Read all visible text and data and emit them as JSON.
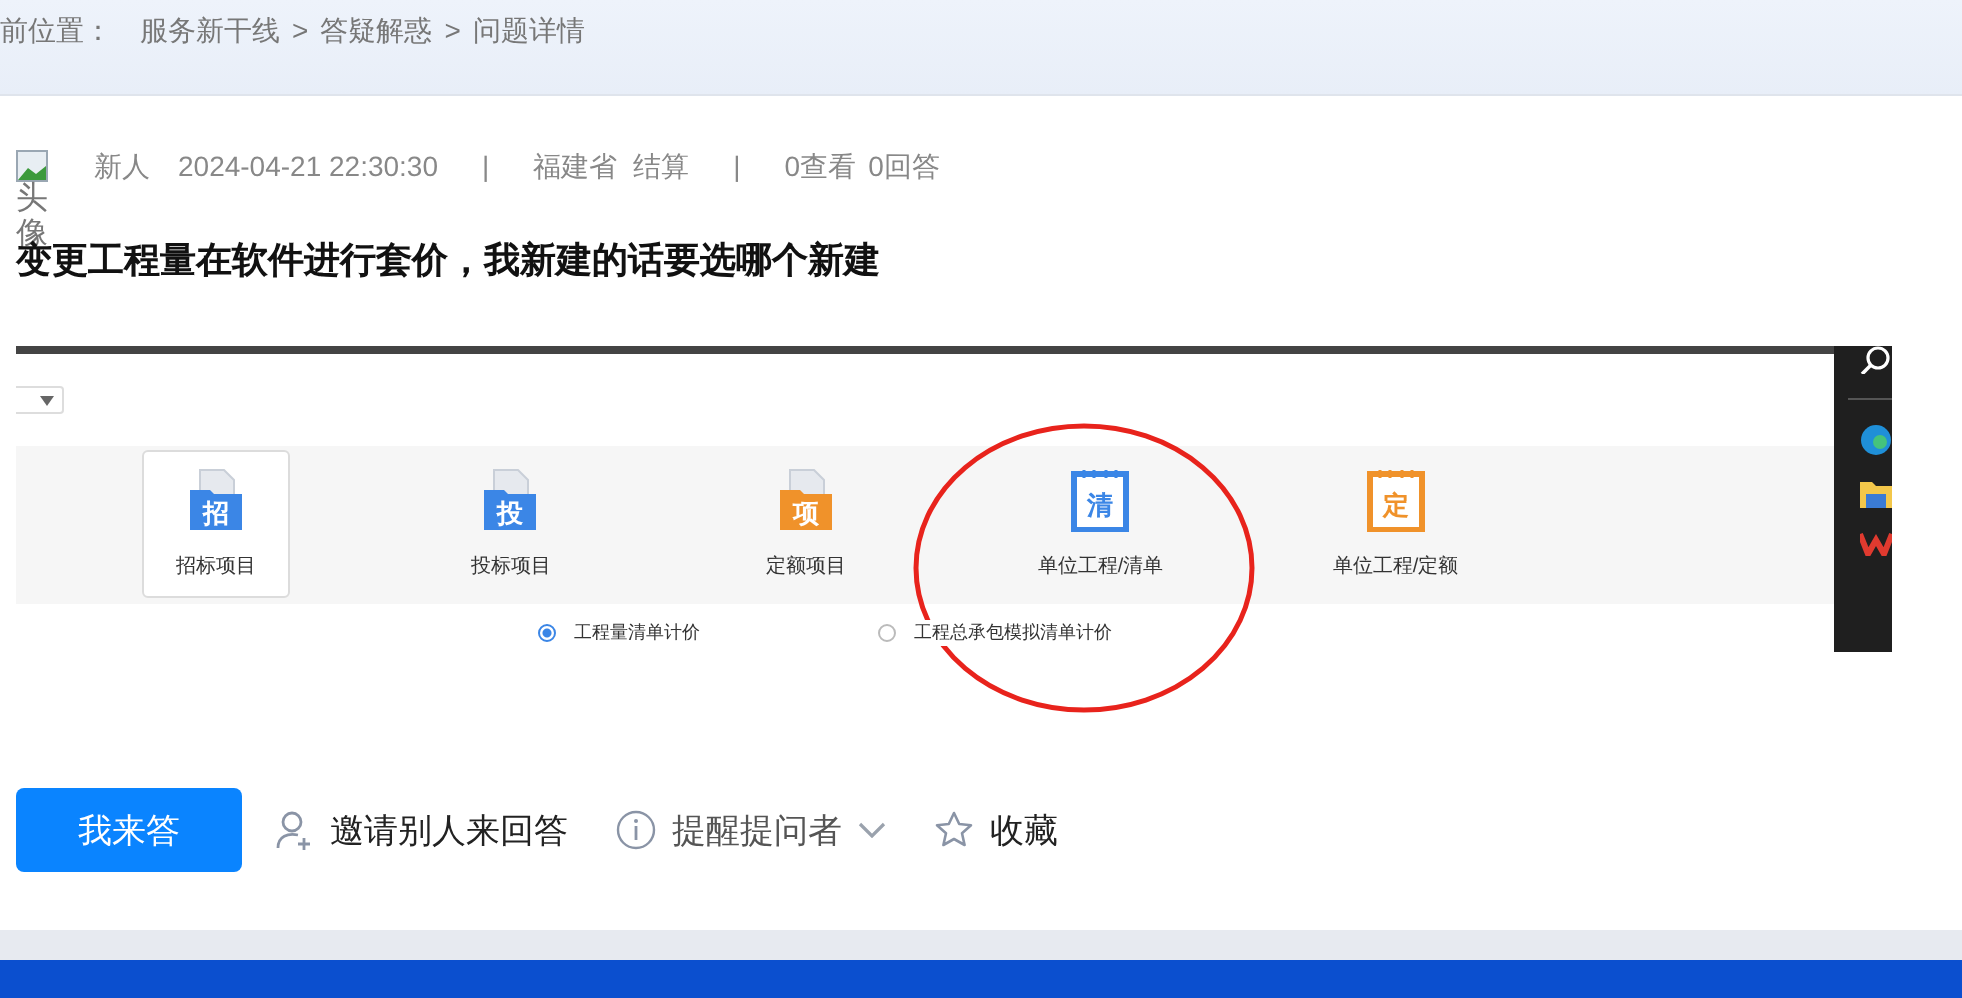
{
  "breadcrumb": {
    "label": "前位置：",
    "items": [
      {
        "kind": "link",
        "text": "服务新干线"
      },
      {
        "kind": "separator",
        "text": ">"
      },
      {
        "kind": "link",
        "text": "答疑解惑"
      },
      {
        "kind": "separator",
        "text": ">"
      },
      {
        "kind": "current",
        "text": "问题详情"
      }
    ]
  },
  "meta": {
    "avatar_alt": "头像",
    "author": "新人",
    "time": "2024-04-21 22:30:30",
    "separators": [
      "|",
      "|"
    ],
    "location": [
      "福建省",
      "结算"
    ],
    "stats": [
      "0查看",
      "0回答"
    ]
  },
  "question_title": "变更工程量在软件进行套价，我新建的话要选哪个新建",
  "attachment_screenshot": {
    "tiles": [
      {
        "kind": "folder",
        "glyph": "招",
        "label": "招标项目",
        "color": "#3b86e6",
        "selected": true
      },
      {
        "kind": "folder",
        "glyph": "投",
        "label": "投标项目",
        "color": "#3b86e6",
        "selected": false
      },
      {
        "kind": "folder",
        "glyph": "项",
        "label": "定额项目",
        "color": "#f0922a",
        "selected": false
      },
      {
        "kind": "notebook",
        "glyph": "清",
        "label": "单位工程/清单",
        "color": "#3b86e6",
        "selected": false
      },
      {
        "kind": "notebook",
        "glyph": "定",
        "label": "单位工程/定额",
        "color": "#f0922a",
        "selected": false
      }
    ],
    "radios": [
      {
        "label": "工程量清单计价",
        "selected": true
      },
      {
        "label": "工程总承包模拟清单计价",
        "selected": false
      }
    ]
  },
  "actions": {
    "primary_button": "我来答",
    "links": [
      {
        "kind": "invite",
        "label": "邀请别人来回答",
        "dropdown": false
      },
      {
        "kind": "remind",
        "label": "提醒提问者",
        "dropdown": true
      },
      {
        "kind": "favorite",
        "label": "收藏",
        "dropdown": false
      }
    ]
  }
}
